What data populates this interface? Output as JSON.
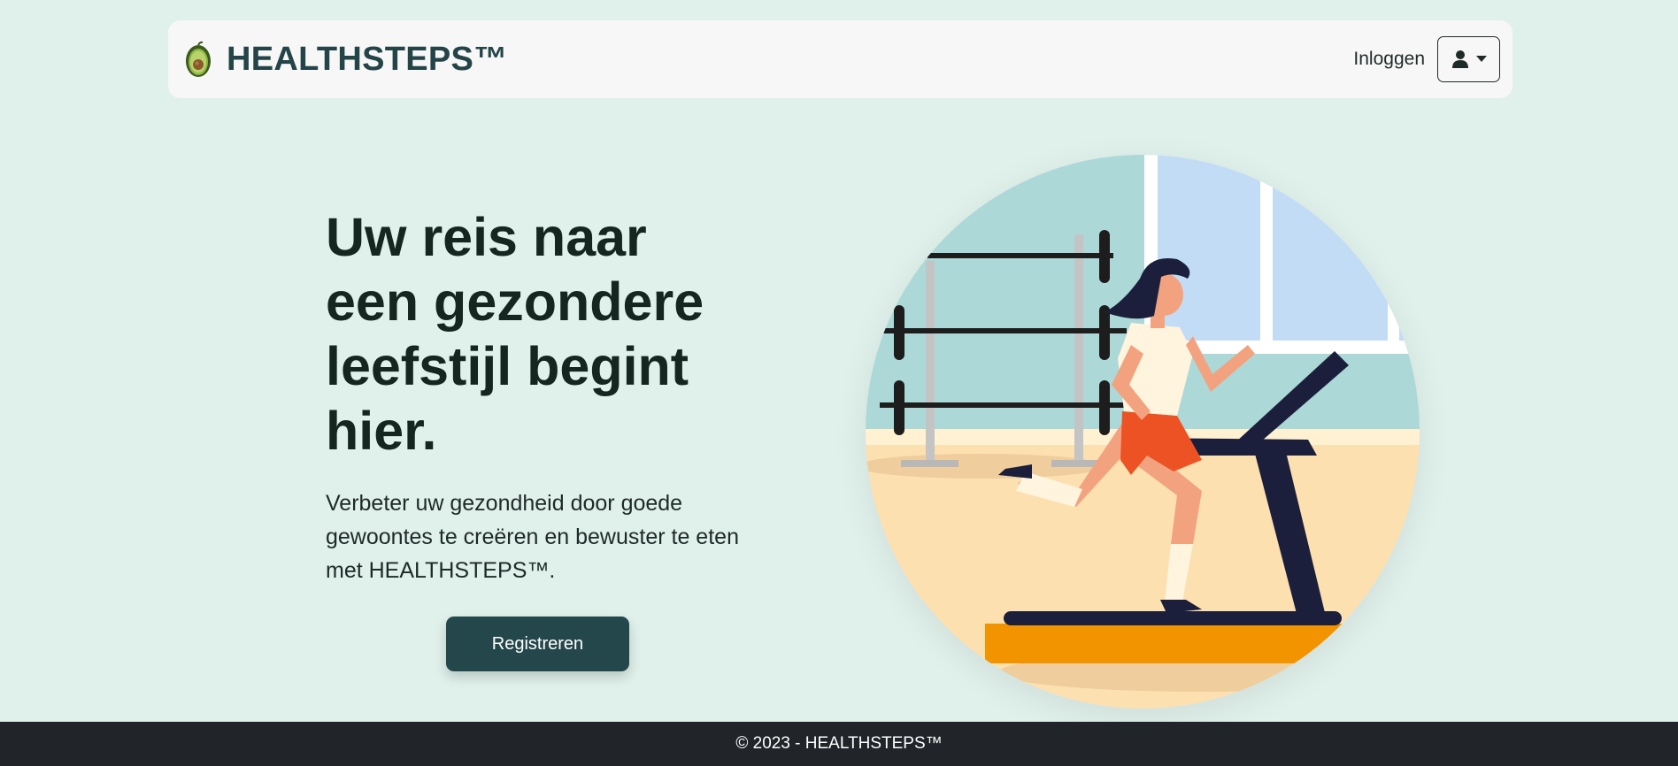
{
  "navbar": {
    "brand_name": "HEALTHSTEPS™",
    "login_label": "Inloggen"
  },
  "hero": {
    "title": "Uw reis naar een gezondere leefstijl begint hier.",
    "subtitle": "Verbeter uw gezondheid door goede gewoontes te creëren en bewuster te eten met HEALTHSTEPS™.",
    "register_label": "Registreren"
  },
  "footer": {
    "copyright": "© 2023 - HEALTHSTEPS™"
  },
  "colors": {
    "background": "#e0f0ea",
    "navbar": "#f7f7f7",
    "brand_text": "#244448",
    "primary_button": "#24474b",
    "footer": "#212529"
  },
  "icons": {
    "brand": "avocado-icon",
    "user_menu": "user-icon",
    "dropdown": "caret-down-icon"
  }
}
